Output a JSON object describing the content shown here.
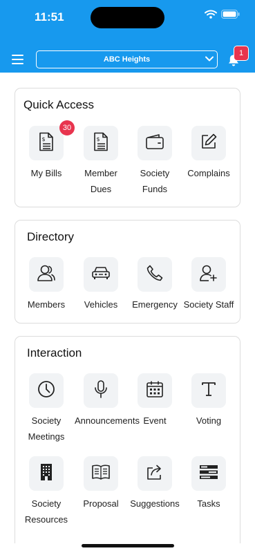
{
  "status_bar": {
    "time": "11:51"
  },
  "header": {
    "society": "ABC Heights",
    "notification_count": "1"
  },
  "quick_access": {
    "title": "Quick Access",
    "items": [
      {
        "label": "My Bills",
        "icon": "bill-icon",
        "badge": "30"
      },
      {
        "label": "Member Dues",
        "icon": "dues-document-icon"
      },
      {
        "label": "Society Funds",
        "icon": "wallet-icon"
      },
      {
        "label": "Complains",
        "icon": "edit-icon"
      }
    ]
  },
  "directory": {
    "title": "Directory",
    "items": [
      {
        "label": "Members",
        "icon": "users-icon"
      },
      {
        "label": "Vehicles",
        "icon": "car-icon"
      },
      {
        "label": "Emergency",
        "icon": "phone-icon"
      },
      {
        "label": "Society Staff",
        "icon": "add-user-icon"
      }
    ]
  },
  "interaction": {
    "title": "Interaction",
    "items": [
      {
        "label": "Society Meetings",
        "icon": "clock-icon"
      },
      {
        "label": "Announcements",
        "icon": "microphone-icon"
      },
      {
        "label": "Event",
        "icon": "calendar-icon"
      },
      {
        "label": "Voting",
        "icon": "text-icon"
      },
      {
        "label": "Society Resources",
        "icon": "building-icon"
      },
      {
        "label": "Proposal",
        "icon": "book-icon"
      },
      {
        "label": "Suggestions",
        "icon": "share-icon"
      },
      {
        "label": "Tasks",
        "icon": "tasks-icon"
      }
    ]
  }
}
